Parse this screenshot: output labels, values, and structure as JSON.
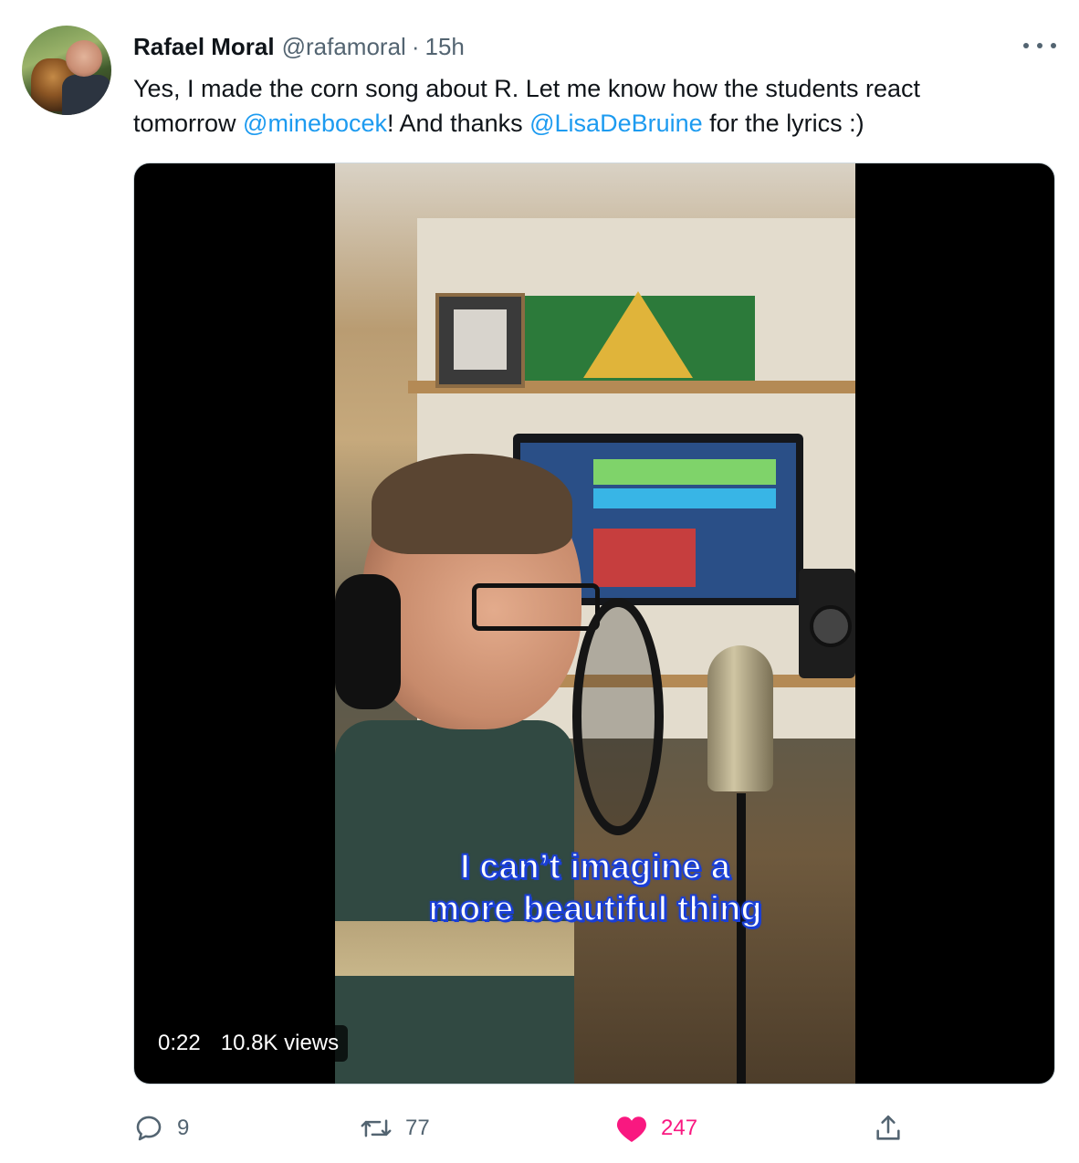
{
  "tweet": {
    "author_name": "Rafael Moral",
    "author_handle": "@rafamoral",
    "separator": "·",
    "time": "15h",
    "text_line1": "Yes, I made the corn song about R. Let me know how the students react",
    "text_line2_start": "tomorrow ",
    "mention1": "@minebocek",
    "text_line2_mid": "! And thanks ",
    "mention2": "@LisaDeBruine",
    "text_line2_end": " for the lyrics :)"
  },
  "video": {
    "caption_line1": "I can’t imagine a",
    "caption_line2": "more beautiful thing",
    "duration": "0:22",
    "views": "10.8K views"
  },
  "actions": {
    "reply_count": "9",
    "retweet_count": "77",
    "like_count": "247"
  },
  "icons": {
    "more": "more-icon",
    "reply": "reply-icon",
    "retweet": "retweet-icon",
    "like": "heart-icon",
    "share": "share-icon"
  },
  "colors": {
    "link": "#1d9bf0",
    "secondary_text": "#536471",
    "like": "#f91880",
    "caption_outline": "#1a3fd6"
  }
}
